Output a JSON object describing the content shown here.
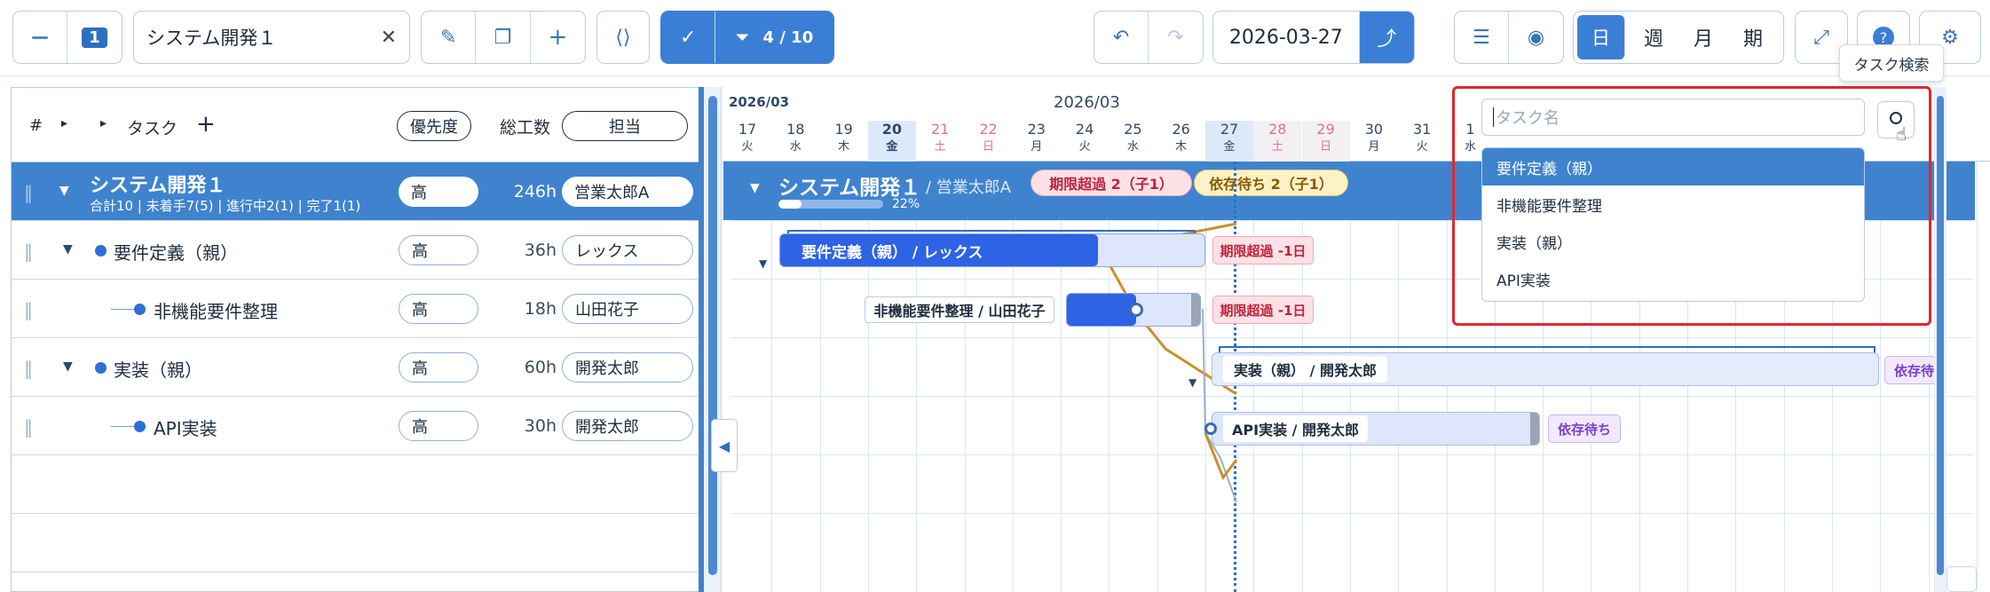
{
  "toolbar": {
    "collapse_icon": "minus-icon",
    "level": "1",
    "project_name": "システム開発１",
    "clear_icon": "close-icon",
    "filter_count": "4 / 10",
    "date": "2026-03-27",
    "view_modes": [
      "日",
      "週",
      "月",
      "期"
    ],
    "active_view": "日",
    "tooltip": "タスク検索"
  },
  "left": {
    "headers": {
      "num": "#",
      "task": "タスク",
      "add": "+",
      "priority": "優先度",
      "effort": "総工数",
      "owner": "担当"
    },
    "rows": [
      {
        "name": "システム開発１",
        "sub": "合計10 | 未着手7(5) | 進行中2(1) | 完了1(1)",
        "priority": "高",
        "effort": "246h",
        "owner": "営業太郎A"
      },
      {
        "name": "要件定義（親）",
        "priority": "高",
        "effort": "36h",
        "owner": "レックス"
      },
      {
        "name": "非機能要件整理",
        "priority": "高",
        "effort": "18h",
        "owner": "山田花子"
      },
      {
        "name": "実装（親）",
        "priority": "高",
        "effort": "60h",
        "owner": "開発太郎"
      },
      {
        "name": "API実装",
        "priority": "高",
        "effort": "30h",
        "owner": "開発太郎"
      }
    ]
  },
  "gantt": {
    "month_left": "2026/03",
    "month_center": "2026/03",
    "days": [
      {
        "d": "17",
        "w": "火"
      },
      {
        "d": "18",
        "w": "水"
      },
      {
        "d": "19",
        "w": "木"
      },
      {
        "d": "20",
        "w": "金"
      },
      {
        "d": "21",
        "w": "土"
      },
      {
        "d": "22",
        "w": "日"
      },
      {
        "d": "23",
        "w": "月"
      },
      {
        "d": "24",
        "w": "火"
      },
      {
        "d": "25",
        "w": "水"
      },
      {
        "d": "26",
        "w": "木"
      },
      {
        "d": "27",
        "w": "金"
      },
      {
        "d": "28",
        "w": "土"
      },
      {
        "d": "29",
        "w": "日"
      },
      {
        "d": "30",
        "w": "月"
      },
      {
        "d": "31",
        "w": "火"
      },
      {
        "d": "1",
        "w": "水"
      }
    ],
    "summary_title": "システム開発１",
    "summary_owner": "/ 営業太郎A",
    "summary_progress": 0.22,
    "summary_progress_label": "22%",
    "badge_overdue": "期限超過 2（子1）",
    "badge_waiting": "依存待ち 2（子1）",
    "bars": {
      "req": "要件定義（親） / レックス",
      "nfr": "非機能要件整理 / 山田花子",
      "impl": "実装（親） / 開発太郎",
      "api": "API実装 / 開発太郎"
    },
    "tag_overdue": "期限超過 -1日",
    "tag_waiting": "依存待ち",
    "tag_waiting_cut": "依存待"
  },
  "search": {
    "placeholder": "タスク名",
    "results": [
      "要件定義（親）",
      "非機能要件整理",
      "実装（親）",
      "API実装"
    ]
  },
  "colors": {
    "accent": "#3a7fd5",
    "header_row": "#3f83cf",
    "overdue": "#e0344e",
    "waiting": "#8a5bd6",
    "highlight": "#e3262c"
  }
}
